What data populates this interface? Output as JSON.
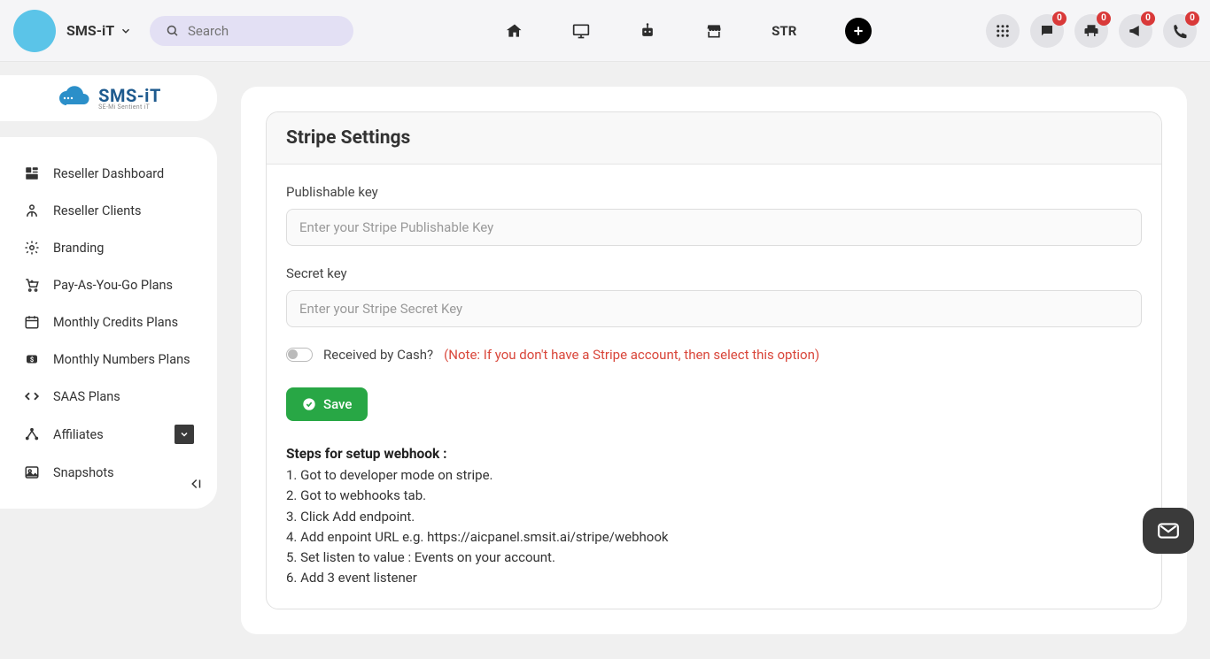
{
  "header": {
    "brand": "SMS-iT",
    "search_placeholder": "Search",
    "str_label": "STR",
    "badge_chat": "0",
    "badge_print": "0",
    "badge_announce": "0",
    "badge_phone": "0"
  },
  "logo": {
    "title": "SMS-iT",
    "subtitle": "SE-Mi Sentient iT"
  },
  "sidebar": {
    "items": [
      {
        "label": "Reseller Dashboard",
        "icon": "dashboard"
      },
      {
        "label": "Reseller Clients",
        "icon": "clients"
      },
      {
        "label": "Branding",
        "icon": "gear"
      },
      {
        "label": "Pay-As-You-Go Plans",
        "icon": "cart"
      },
      {
        "label": "Monthly Credits Plans",
        "icon": "calendar"
      },
      {
        "label": "Monthly Numbers Plans",
        "icon": "money"
      },
      {
        "label": "SAAS Plans",
        "icon": "code"
      },
      {
        "label": "Affiliates",
        "icon": "affiliate",
        "has_chevron": true
      },
      {
        "label": "Snapshots",
        "icon": "image"
      }
    ]
  },
  "card": {
    "title": "Stripe Settings",
    "publishable_label": "Publishable key",
    "publishable_placeholder": "Enter your Stripe Publishable Key",
    "secret_label": "Secret key",
    "secret_placeholder": "Enter your Stripe Secret Key",
    "toggle_label": "Received by Cash?",
    "toggle_note": "(Note: If you don't have a Stripe account, then select this option)",
    "save_label": "Save",
    "steps_title": "Steps for setup webhook :",
    "steps": [
      "1. Got to developer mode on stripe.",
      "2. Got to webhooks tab.",
      "3. Click Add endpoint.",
      "4. Add enpoint URL e.g. https://aicpanel.smsit.ai/stripe/webhook",
      "5. Set listen to value : Events on your account.",
      "6. Add 3 event listener"
    ]
  }
}
